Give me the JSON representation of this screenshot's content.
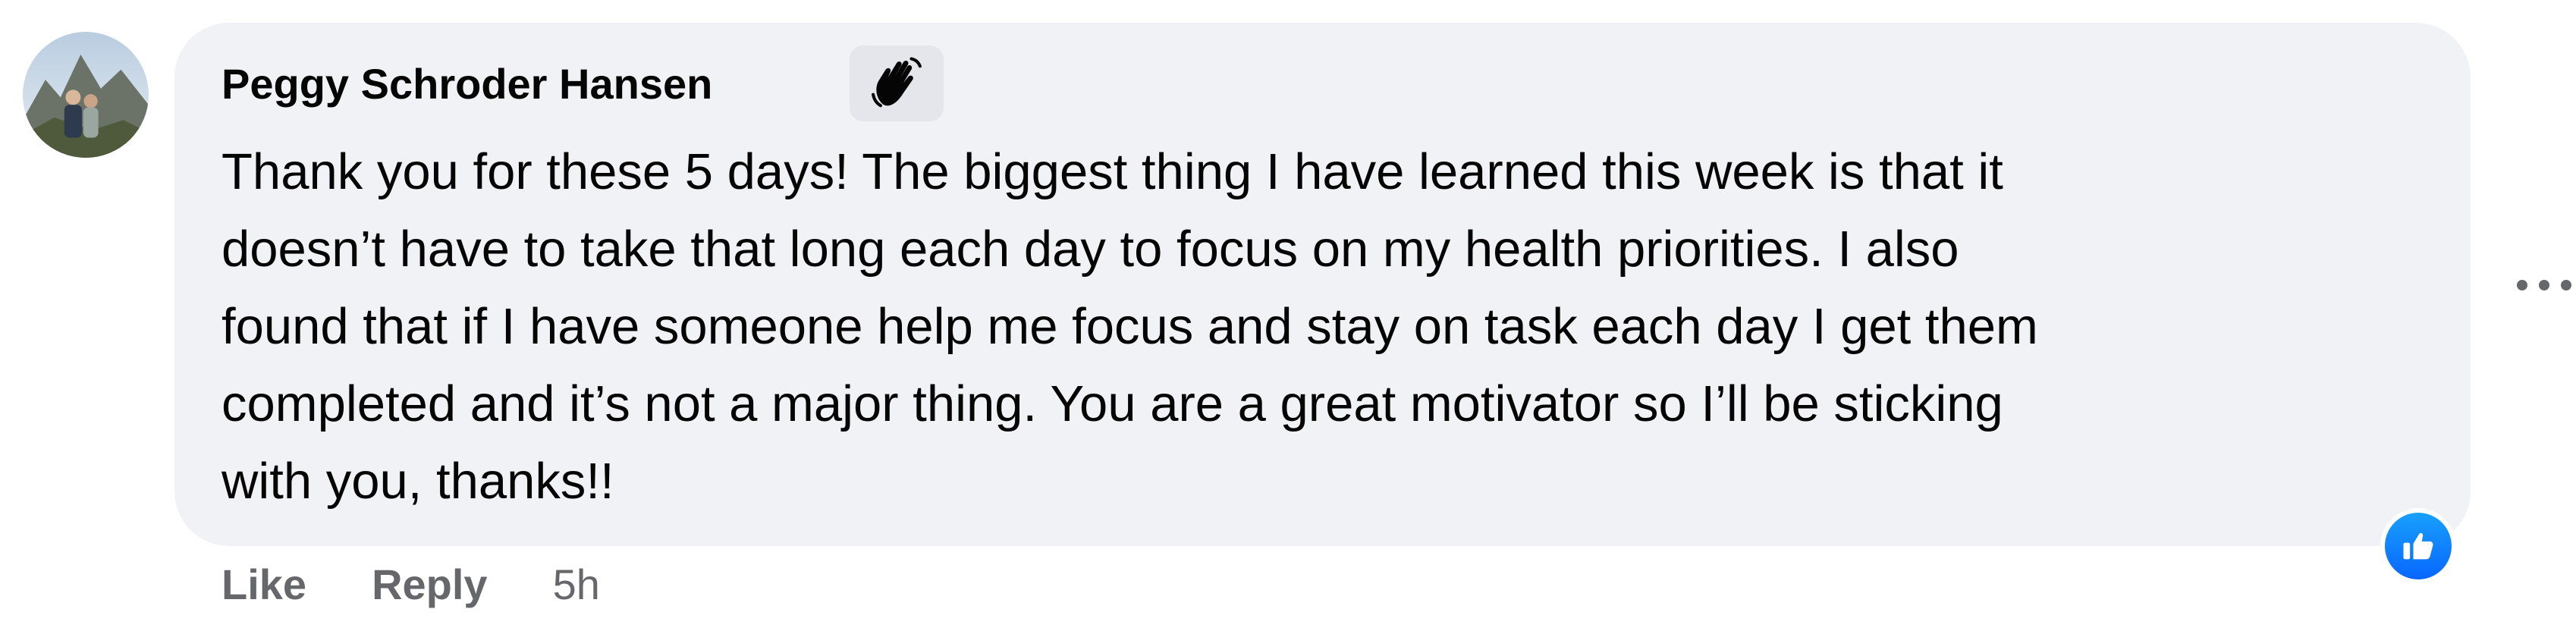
{
  "comment": {
    "author": "Peggy Schroder Hansen",
    "badge_icon": "waving-hand-icon",
    "text": "Thank you for these 5 days! The biggest thing I have learned this week is that it\ndoesn’t have to take that long each day to focus on my health priorities. I also\nfound that if I have someone help me focus and stay on task each day I get them\ncompleted and it’s not a major thing. You are a great motivator so I’ll be sticking\nwith you, thanks!!",
    "reaction_icon": "thumbs-up-icon",
    "more_icon": "more-options-icon"
  },
  "actions": {
    "like_label": "Like",
    "reply_label": "Reply",
    "timestamp": "5h"
  },
  "colors": {
    "bubble": "#f0f2f5",
    "text": "#050505",
    "muted": "#65676b",
    "like_blue": "#0866ff"
  }
}
